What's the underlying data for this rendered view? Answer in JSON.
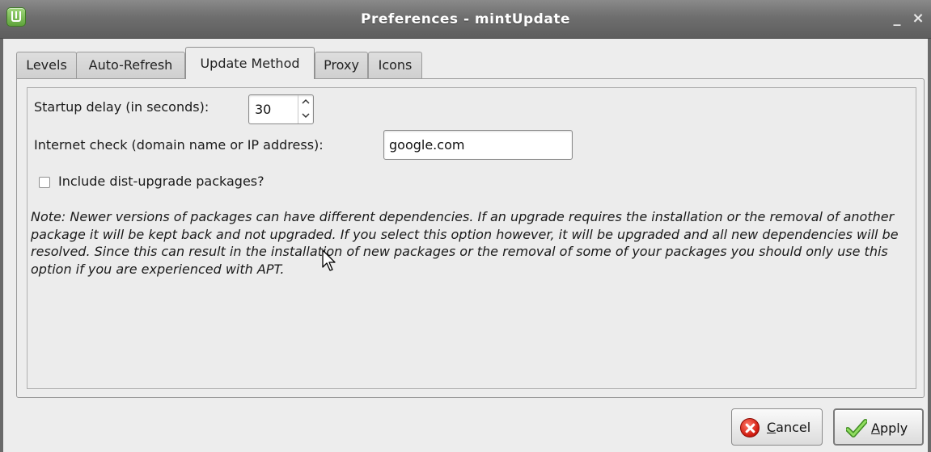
{
  "window": {
    "title": "Preferences - mintUpdate",
    "minimize_glyph": "_",
    "close_glyph": "×",
    "app_icon": "mint-update-icon"
  },
  "tabs": [
    {
      "label": "Levels",
      "active": false
    },
    {
      "label": "Auto-Refresh",
      "active": false
    },
    {
      "label": "Update Method",
      "active": true
    },
    {
      "label": "Proxy",
      "active": false
    },
    {
      "label": "Icons",
      "active": false
    }
  ],
  "update_method": {
    "startup_delay": {
      "label": "Startup delay (in seconds):",
      "value": "30"
    },
    "internet_check": {
      "label": "Internet check (domain name or IP address):",
      "value": "google.com"
    },
    "dist_upgrade": {
      "label": "Include dist-upgrade packages?",
      "checked": false
    },
    "note": "Note: Newer versions of packages can have different dependencies. If an upgrade requires the installation or the removal of another package it will be kept back and not upgraded. If you select this option however, it will be upgraded and all new dependencies will be resolved. Since this can result in the installation of new packages or the removal of some of your packages you should only use this option if you are experienced with APT."
  },
  "buttons": {
    "cancel": {
      "mnemonic": "C",
      "rest": "ancel",
      "icon": "cancel-icon"
    },
    "apply": {
      "mnemonic": "A",
      "rest": "pply",
      "icon": "checkmark-icon"
    }
  },
  "colors": {
    "titlebar": "#6e6e6e",
    "background": "#ededed",
    "cancel_red": "#d21e12",
    "apply_green": "#5fb83a"
  }
}
